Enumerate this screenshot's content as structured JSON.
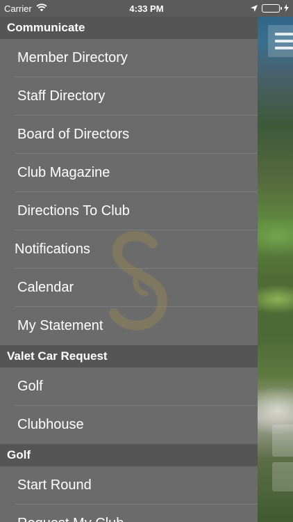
{
  "status_bar": {
    "carrier": "Carrier",
    "time": "4:33 PM",
    "battery_color": "#44d35a"
  },
  "menu": {
    "sections": [
      {
        "title": "Communicate",
        "items": [
          "Member Directory",
          "Staff Directory",
          "Board of Directors",
          "Club Magazine",
          "Directions To Club",
          "Notifications",
          "Calendar",
          "My Statement"
        ]
      },
      {
        "title": "Valet Car Request",
        "items": [
          "Golf",
          "Clubhouse"
        ]
      },
      {
        "title": "Golf",
        "items": [
          "Start Round",
          "Request My Club"
        ]
      }
    ]
  },
  "icons": {
    "wifi": "wifi-icon",
    "location": "location-arrow-icon",
    "battery": "battery-icon",
    "charging": "charging-bolt-icon",
    "menu": "hamburger-menu-icon",
    "watermark": "club-logo-s"
  }
}
